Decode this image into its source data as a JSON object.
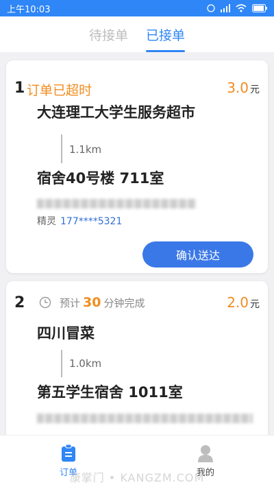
{
  "status_bar": {
    "time": "上午10:03"
  },
  "tabs": [
    {
      "label": "待接单",
      "active": false
    },
    {
      "label": "已接单",
      "active": true
    }
  ],
  "orders": [
    {
      "index": "1",
      "status": "订单已超时",
      "price": "3.0",
      "unit": "元",
      "shop": "大连理工大学生服务超市",
      "distance": "1.1km",
      "destination": "宿舍40号楼 711室",
      "contact_name": "精灵",
      "contact_phone": "177****5321",
      "action_label": "确认送达"
    },
    {
      "index": "2",
      "eta_prefix": "预计",
      "eta_minutes": "30",
      "eta_suffix": "分钟完成",
      "price": "2.0",
      "unit": "元",
      "shop": "四川冒菜",
      "distance": "1.0km",
      "destination": "第五学生宿舍 1011室"
    }
  ],
  "bottom_nav": [
    {
      "label": "订单",
      "icon": "clipboard-icon",
      "active": true
    },
    {
      "label": "我的",
      "icon": "user-icon",
      "active": false
    }
  ],
  "watermark": "康掌门 • KANGZM.COM",
  "colors": {
    "accent": "#2f86f6",
    "orange": "#f28c1e",
    "button": "#3b78e7"
  }
}
